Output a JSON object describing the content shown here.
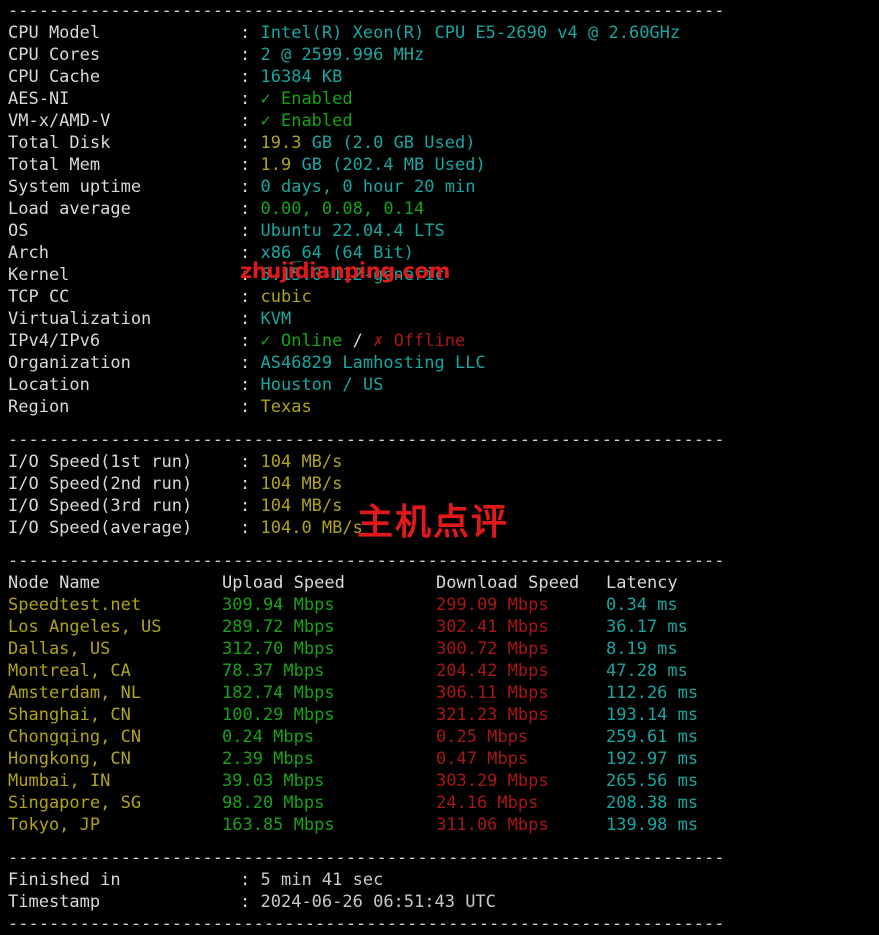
{
  "terminal": {
    "separator": "----------------------------------------------------------------------",
    "colon": ":"
  },
  "system_info": {
    "rows": [
      {
        "label": "CPU Model",
        "value": "Intel(R) Xeon(R) CPU E5-2690 v4 @ 2.60GHz",
        "color": "cyan"
      },
      {
        "label": "CPU Cores",
        "value": "2 @ 2599.996 MHz",
        "color": "cyan"
      },
      {
        "label": "CPU Cache",
        "value": "16384 KB",
        "color": "cyan"
      },
      {
        "label": "AES-NI",
        "value": "✓ Enabled",
        "color": "green"
      },
      {
        "label": "VM-x/AMD-V",
        "value": "✓ Enabled",
        "color": "green"
      },
      {
        "label": "Total Disk",
        "value": "19.3 GB (2.0 GB Used)",
        "color": "yellow-cyan"
      },
      {
        "label": "Total Mem",
        "value": "1.9 GB (202.4 MB Used)",
        "color": "yellow-cyan"
      },
      {
        "label": "System uptime",
        "value": "0 days, 0 hour 20 min",
        "color": "cyan"
      },
      {
        "label": "Load average",
        "value": "0.00, 0.08, 0.14",
        "color": "green"
      },
      {
        "label": "OS",
        "value": "Ubuntu 22.04.4 LTS",
        "color": "cyan"
      },
      {
        "label": "Arch",
        "value": "x86_64 (64 Bit)",
        "color": "cyan"
      },
      {
        "label": "Kernel",
        "value": "5.15.0-112-generic",
        "color": "cyan"
      },
      {
        "label": "TCP CC",
        "value": "cubic",
        "color": "yellow"
      },
      {
        "label": "Virtualization",
        "value": "KVM",
        "color": "cyan"
      },
      {
        "label": "IPv4/IPv6",
        "value": "✓ Online / ✗ Offline",
        "color": "mixed"
      },
      {
        "label": "Organization",
        "value": "AS46829 Lamhosting LLC",
        "color": "cyan"
      },
      {
        "label": "Location",
        "value": "Houston / US",
        "color": "cyan"
      },
      {
        "label": "Region",
        "value": "Texas",
        "color": "yellow"
      }
    ],
    "ipv4_status": "✓ Online",
    "ipv4_sep": " / ",
    "ipv6_status": "✗ Offline",
    "disk_num": "19.3",
    "disk_rest": " GB (2.0 GB Used)",
    "mem_num": "1.9",
    "mem_rest": " GB (202.4 MB Used)"
  },
  "io_speed": {
    "rows": [
      {
        "label": "I/O Speed(1st run)",
        "value": "104 MB/s"
      },
      {
        "label": "I/O Speed(2nd run)",
        "value": "104 MB/s"
      },
      {
        "label": "I/O Speed(3rd run)",
        "value": "104 MB/s"
      },
      {
        "label": "I/O Speed(average)",
        "value": "104.0 MB/s"
      }
    ]
  },
  "speedtest": {
    "headers": {
      "node": "Node Name",
      "upload": "Upload Speed",
      "download": "Download Speed",
      "latency": "Latency"
    },
    "rows": [
      {
        "node": "Speedtest.net",
        "upload": "309.94 Mbps",
        "download": "299.09 Mbps",
        "latency": "0.34 ms"
      },
      {
        "node": "Los Angeles, US",
        "upload": "289.72 Mbps",
        "download": "302.41 Mbps",
        "latency": "36.17 ms"
      },
      {
        "node": "Dallas, US",
        "upload": "312.70 Mbps",
        "download": "300.72 Mbps",
        "latency": "8.19 ms"
      },
      {
        "node": "Montreal, CA",
        "upload": "78.37 Mbps",
        "download": "204.42 Mbps",
        "latency": "47.28 ms"
      },
      {
        "node": "Amsterdam, NL",
        "upload": "182.74 Mbps",
        "download": "306.11 Mbps",
        "latency": "112.26 ms"
      },
      {
        "node": "Shanghai, CN",
        "upload": "100.29 Mbps",
        "download": "321.23 Mbps",
        "latency": "193.14 ms"
      },
      {
        "node": "Chongqing, CN",
        "upload": "0.24 Mbps",
        "download": "0.25 Mbps",
        "latency": "259.61 ms"
      },
      {
        "node": "Hongkong, CN",
        "upload": "2.39 Mbps",
        "download": "0.47 Mbps",
        "latency": "192.97 ms"
      },
      {
        "node": "Mumbai, IN",
        "upload": "39.03 Mbps",
        "download": "303.29 Mbps",
        "latency": "265.56 ms"
      },
      {
        "node": "Singapore, SG",
        "upload": "98.20 Mbps",
        "download": "24.16 Mbps",
        "latency": "208.38 ms"
      },
      {
        "node": "Tokyo, JP",
        "upload": "163.85 Mbps",
        "download": "311.06 Mbps",
        "latency": "139.98 ms"
      }
    ]
  },
  "footer": {
    "rows": [
      {
        "label": "Finished in",
        "value": "5 min 41 sec"
      },
      {
        "label": "Timestamp",
        "value": "2024-06-26 06:51:43 UTC"
      }
    ]
  },
  "watermarks": {
    "url": "zhujidianping.com",
    "cn": "主机点评",
    "color": "#e01a1a"
  },
  "colors": {
    "background": "#000000",
    "label": "#d8d8d8",
    "cyan": "#18a6a0",
    "green": "#17a317",
    "yellow": "#b0a31c",
    "red": "#a81717"
  }
}
